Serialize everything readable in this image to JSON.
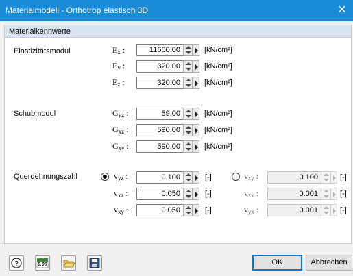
{
  "window": {
    "title": "Materialmodell - Orthotrop elastisch 3D"
  },
  "group": {
    "header": "Materialkennwerte"
  },
  "sections": {
    "elastic_label": "Elastizitätsmodul",
    "shear_label": "Schubmodul",
    "poisson_label": "Querdehnungszahl"
  },
  "elastic": [
    {
      "sym": "E",
      "sub": "x",
      "value": "11600.00",
      "unit": "[kN/cm²]"
    },
    {
      "sym": "E",
      "sub": "y",
      "value": "320.00",
      "unit": "[kN/cm²]"
    },
    {
      "sym": "E",
      "sub": "z",
      "value": "320.00",
      "unit": "[kN/cm²]"
    }
  ],
  "shear": [
    {
      "sym": "G",
      "sub": "yz",
      "value": "59.00",
      "unit": "[kN/cm²]"
    },
    {
      "sym": "G",
      "sub": "xz",
      "value": "590.00",
      "unit": "[kN/cm²]"
    },
    {
      "sym": "G",
      "sub": "xy",
      "value": "590.00",
      "unit": "[kN/cm²]"
    }
  ],
  "poisson_left": [
    {
      "sym": "v",
      "sub": "yz",
      "value": "0.100",
      "unit": "[-]"
    },
    {
      "sym": "v",
      "sub": "xz",
      "value": "0.050",
      "unit": "[-]"
    },
    {
      "sym": "v",
      "sub": "xy",
      "value": "0.050",
      "unit": "[-]"
    }
  ],
  "poisson_right": [
    {
      "sym": "v",
      "sub": "zy",
      "value": "0.100",
      "unit": "[-]"
    },
    {
      "sym": "v",
      "sub": "zx",
      "value": "0.001",
      "unit": "[-]"
    },
    {
      "sym": "v",
      "sub": "yx",
      "value": "0.001",
      "unit": "[-]"
    }
  ],
  "radio": {
    "left_selected": true,
    "right_selected": false
  },
  "buttons": {
    "ok": "OK",
    "cancel": "Abbrechen"
  },
  "toolbar_icons": [
    "help-icon",
    "decimals-icon",
    "open-folder-icon",
    "save-icon"
  ],
  "toolbar_decimals_text": "0.00",
  "colors": {
    "titlebar": "#1a8bd6",
    "group_header": "#d9e4f1"
  }
}
